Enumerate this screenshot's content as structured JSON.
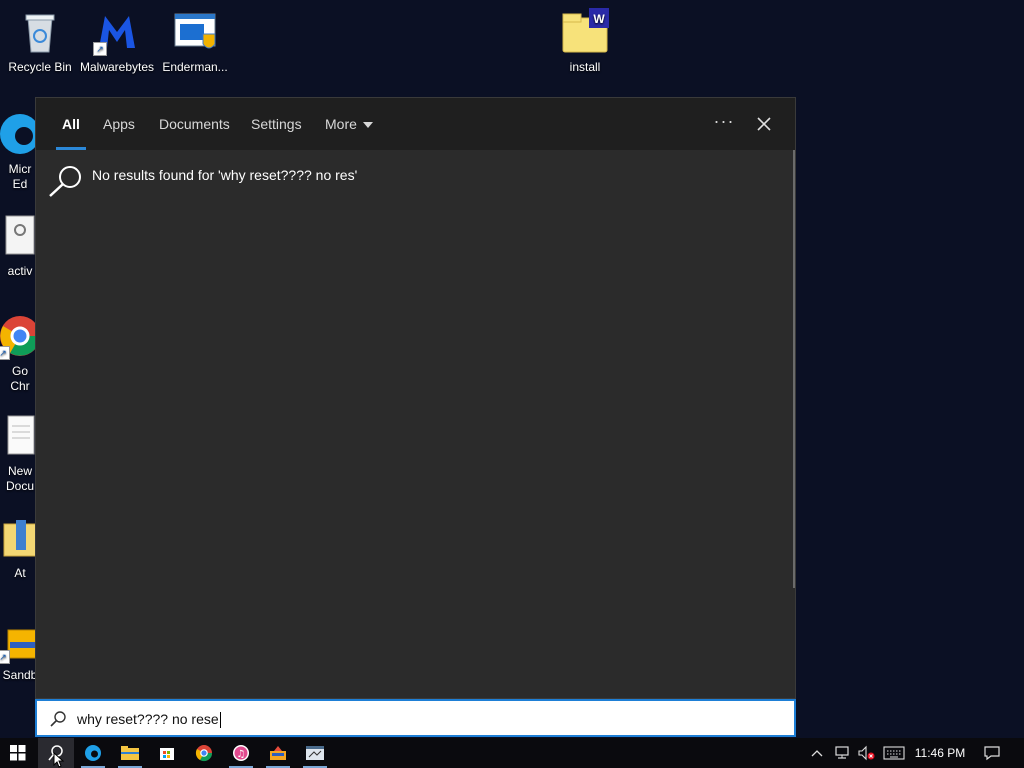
{
  "desktop": {
    "icons": [
      {
        "label": "Recycle Bin"
      },
      {
        "label": "Malwarebytes"
      },
      {
        "label": "Enderman..."
      },
      {
        "label": "install"
      },
      {
        "label": "Micr\nEd"
      },
      {
        "label": "activ"
      },
      {
        "label": "Go\nChr"
      },
      {
        "label": "New\nDocu"
      },
      {
        "label": "At"
      },
      {
        "label": "Sandb"
      }
    ]
  },
  "search": {
    "tabs": [
      {
        "label": "All",
        "active": true
      },
      {
        "label": "Apps"
      },
      {
        "label": "Documents"
      },
      {
        "label": "Settings"
      },
      {
        "label": "More"
      }
    ],
    "ellipsis": "···",
    "no_results_text": "No results found for 'why reset???? no res'",
    "query": "why reset???? no rese"
  },
  "taskbar": {
    "clock": "11:46 PM",
    "apps": [
      "start-button",
      "search-button",
      "edge",
      "file-explorer",
      "store",
      "chrome",
      "itunes",
      "app-7",
      "app-8"
    ]
  },
  "colors": {
    "desktop_bg": "#0b1024",
    "panel_bg": "#2b2b2b",
    "tabbar_bg": "#1f1f1f",
    "accent": "#2b88d8"
  }
}
